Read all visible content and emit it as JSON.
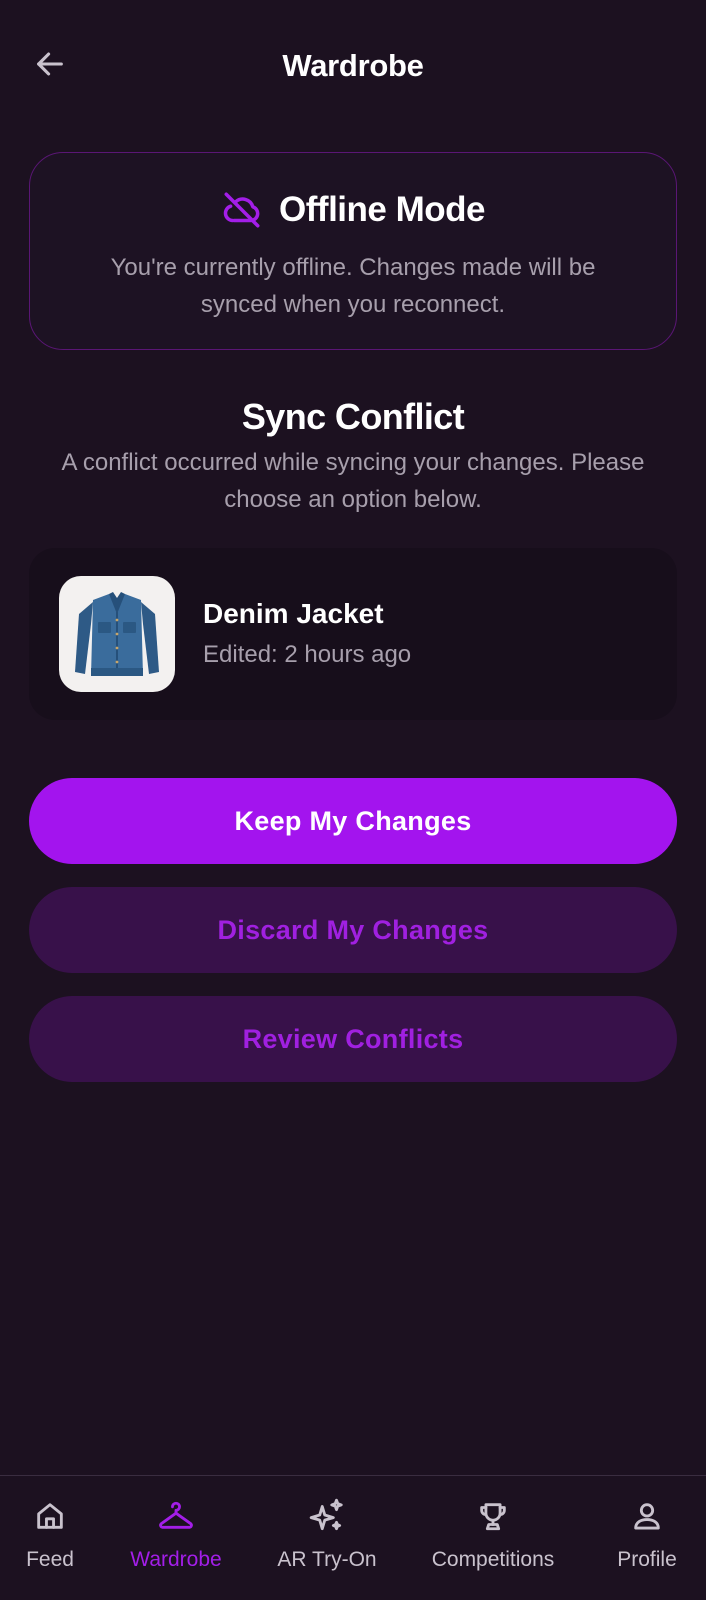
{
  "header": {
    "title": "Wardrobe",
    "back_icon": "arrow-left-icon"
  },
  "offline": {
    "icon": "cloud-off-icon",
    "title": "Offline Mode",
    "message": "You're currently offline. Changes made will be synced when you reconnect."
  },
  "sync": {
    "title": "Sync Conflict",
    "message": "A conflict occurred while syncing your changes. Please choose an option below."
  },
  "item": {
    "name": "Denim Jacket",
    "meta": "Edited: 2 hours ago",
    "thumbnail": "denim-jacket-image"
  },
  "actions": {
    "keep": "Keep My Changes",
    "discard": "Discard My Changes",
    "review": "Review Conflicts"
  },
  "nav": {
    "active": "Wardrobe",
    "items": [
      {
        "label": "Feed",
        "icon": "home-icon"
      },
      {
        "label": "Wardrobe",
        "icon": "hanger-icon"
      },
      {
        "label": "AR Try-On",
        "icon": "sparkles-icon"
      },
      {
        "label": "Competitions",
        "icon": "trophy-icon"
      },
      {
        "label": "Profile",
        "icon": "user-icon"
      }
    ]
  },
  "colors": {
    "background": "#1c1120",
    "accent": "#a314ee",
    "secondary_button": "#38114a",
    "muted_text": "#a79fac"
  }
}
